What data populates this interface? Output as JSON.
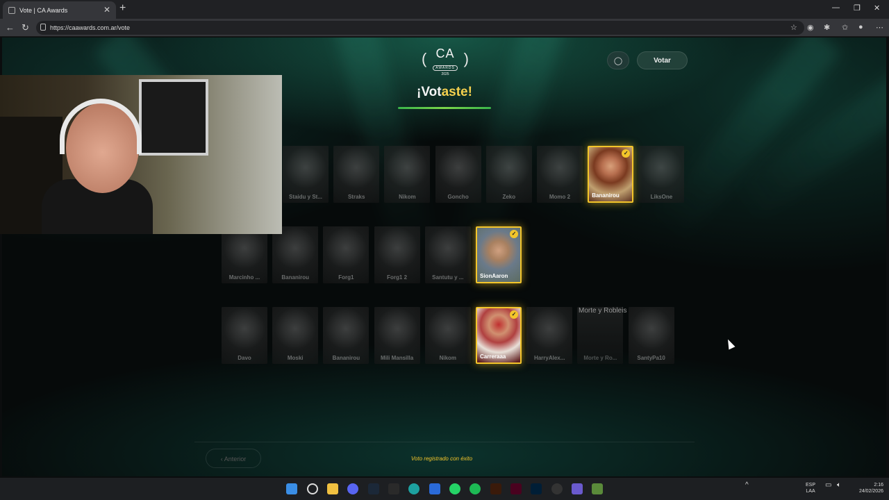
{
  "browser": {
    "tab_title": "Vote | CA Awards",
    "url": "https://caawards.com.ar/vote"
  },
  "header": {
    "logo_ca": "CA",
    "logo_awards": "AWARDS",
    "logo_year": "2025",
    "vote_button": "Votar",
    "title_prefix": "¡Vot",
    "title_highlight": "aste!"
  },
  "rows": [
    {
      "cards": [
        {
          "label": "Staidu y St...",
          "selected": false
        },
        {
          "label": "Straks",
          "selected": false
        },
        {
          "label": "Nikom",
          "selected": false
        },
        {
          "label": "Goncho",
          "selected": false
        },
        {
          "label": "Zeko",
          "selected": false
        },
        {
          "label": "Momo 2",
          "selected": false
        },
        {
          "label": "Bananirou",
          "selected": true
        },
        {
          "label": "LiksOne",
          "selected": false
        }
      ]
    },
    {
      "cards": [
        {
          "label": "Marcinho ...",
          "selected": false
        },
        {
          "label": "Bananirou",
          "selected": false
        },
        {
          "label": "Forg1",
          "selected": false
        },
        {
          "label": "Forg1 2",
          "selected": false
        },
        {
          "label": "Santutu y ...",
          "selected": false
        },
        {
          "label": "SionAaron",
          "selected": true
        }
      ]
    },
    {
      "cards": [
        {
          "label": "Davo",
          "selected": false
        },
        {
          "label": "Moski",
          "selected": false
        },
        {
          "label": "Bananirou",
          "selected": false
        },
        {
          "label": "Mili Mansilla",
          "selected": false
        },
        {
          "label": "Nikom",
          "selected": false
        },
        {
          "label": "Carreraaa",
          "selected": true
        },
        {
          "label": "HarryAlex...",
          "selected": false
        },
        {
          "label": "Morte y Ro...",
          "selected": false
        },
        {
          "label": "SantyPa10",
          "selected": false
        }
      ]
    }
  ],
  "broken_image_alt": "Morte y Robleis",
  "footer": {
    "prev_button": "Anterior",
    "status": "Voto registrado con éxito"
  },
  "taskbar": {
    "lang": "ESP",
    "layout": "LAA",
    "time": "2:16",
    "date": "24/02/2026"
  }
}
